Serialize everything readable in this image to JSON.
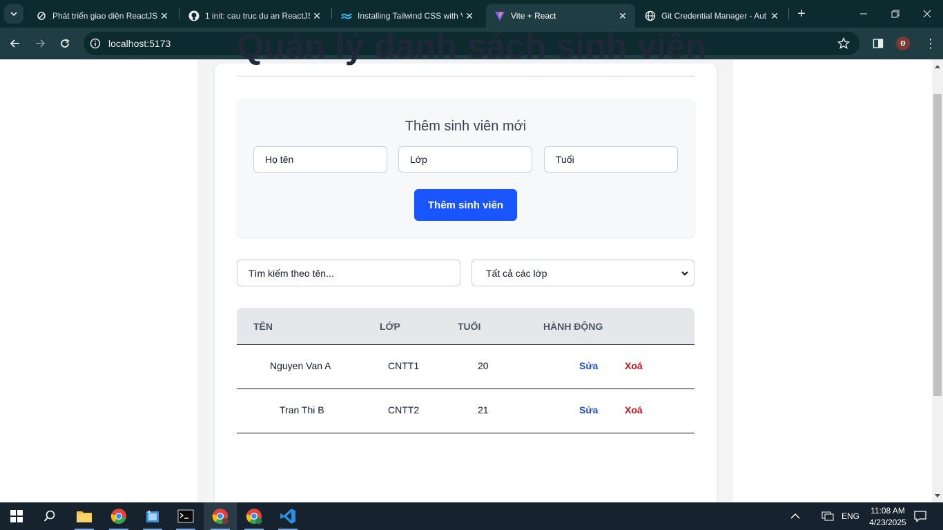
{
  "browser": {
    "tabs": [
      {
        "title": "Phát triển giao diện ReactJS",
        "favicon": "sync-icon",
        "active": false
      },
      {
        "title": "1 init: cau truc du an ReactJS",
        "favicon": "github-icon",
        "active": false
      },
      {
        "title": "Installing Tailwind CSS with V",
        "favicon": "tailwind-icon",
        "active": false
      },
      {
        "title": "Vite + React",
        "favicon": "vite-icon",
        "active": true
      },
      {
        "title": "Git Credential Manager - Aut",
        "favicon": "globe-icon",
        "active": false
      }
    ],
    "url": "localhost:5173",
    "profile_initial": "Đ"
  },
  "page": {
    "title": "Quản lý danh sách sinh viên",
    "form": {
      "heading": "Thêm sinh viên mới",
      "name_placeholder": "Họ tên",
      "class_placeholder": "Lớp",
      "age_placeholder": "Tuổi",
      "submit_label": "Thêm sinh viên"
    },
    "search_placeholder": "Tìm kiếm theo tên...",
    "class_filter": {
      "selected": "Tất cả các lớp"
    },
    "table": {
      "headers": [
        "TÊN",
        "LỚP",
        "TUỔI",
        "HÀNH ĐỘNG"
      ],
      "rows": [
        {
          "name": "Nguyen Van A",
          "class": "CNTT1",
          "age": "20",
          "edit": "Sửa",
          "delete": "Xoá"
        },
        {
          "name": "Tran Thi B",
          "class": "CNTT2",
          "age": "21",
          "edit": "Sửa",
          "delete": "Xoá"
        }
      ]
    }
  },
  "taskbar": {
    "language": "ENG",
    "time": "11:08 AM",
    "date": "4/23/2025"
  },
  "colors": {
    "primary_button": "#1a56ff",
    "edit_link": "#1d4ed8",
    "delete_link": "#c1121f",
    "title_text": "#1f2937",
    "chrome_dark": "#0d2a2f",
    "chrome_toolbar": "#1f3d42"
  }
}
